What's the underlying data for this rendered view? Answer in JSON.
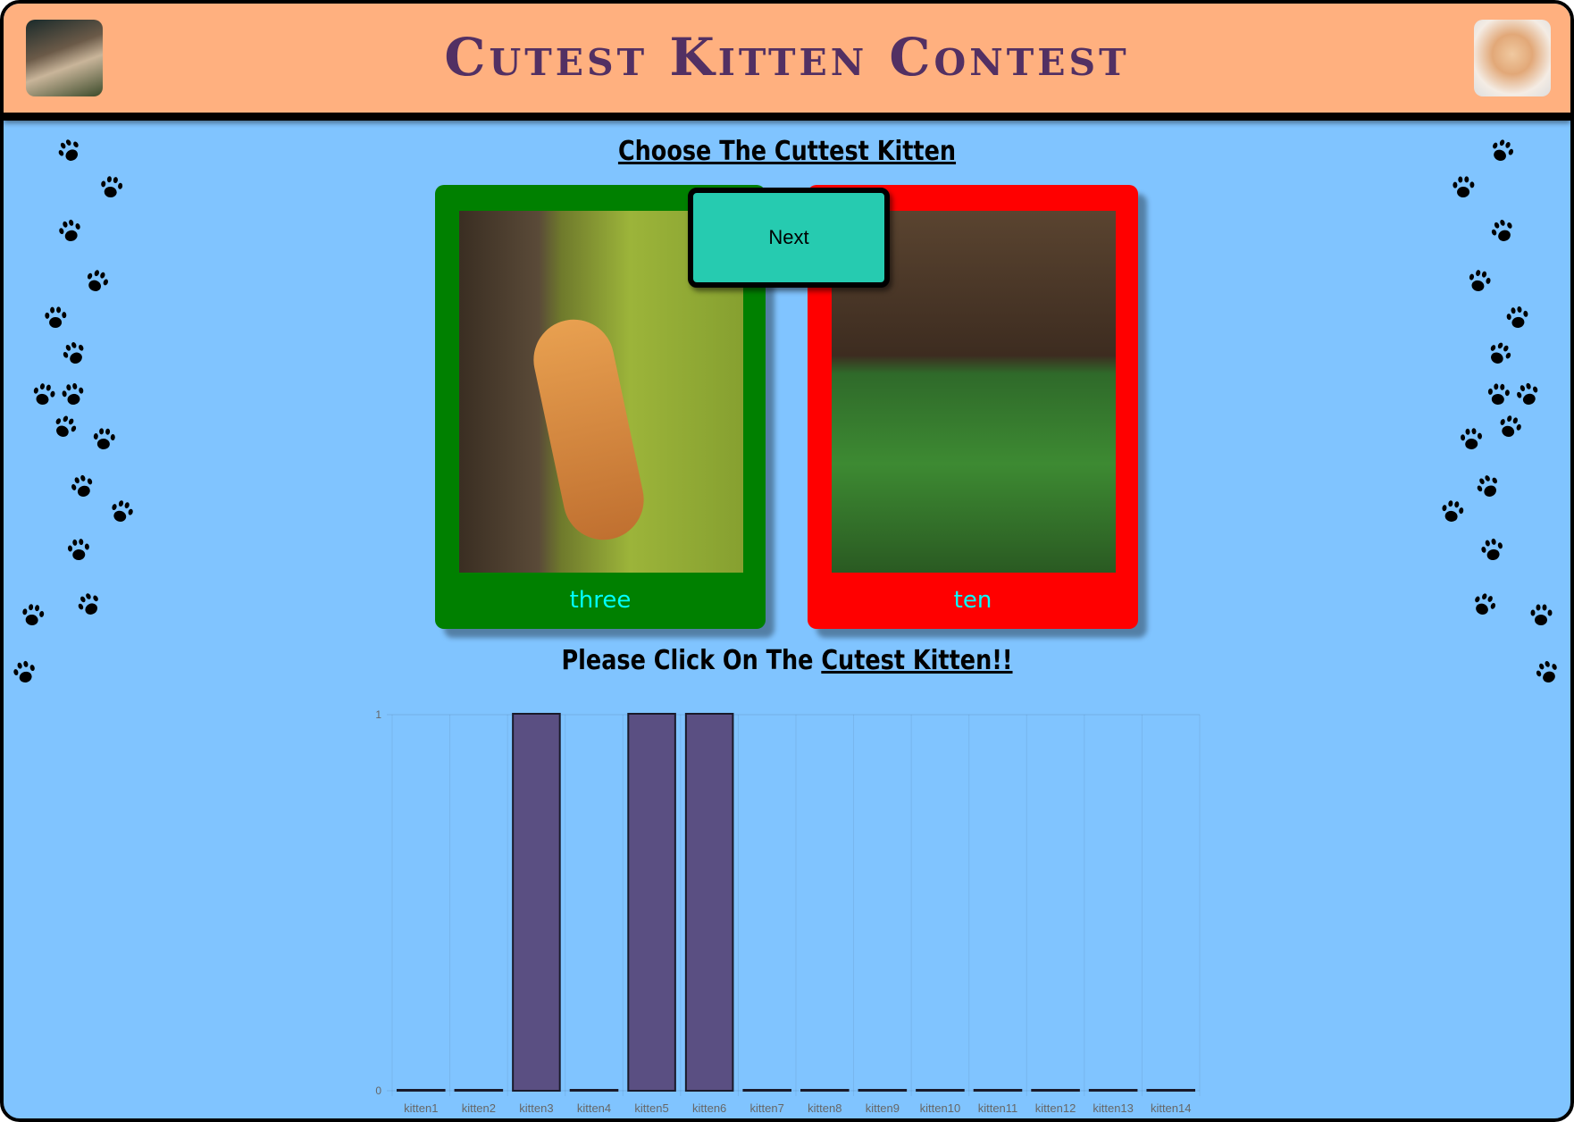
{
  "header": {
    "title": "Cutest Kitten Contest"
  },
  "main": {
    "heading": "Choose The Cuttest Kitten",
    "left_card": {
      "label": "three",
      "color": "#008000"
    },
    "right_card": {
      "label": "ten",
      "color": "#FF0000"
    },
    "next_label": "Next",
    "prompt_prefix": "Please Click On The ",
    "prompt_emphasis": "Cutest Kitten!!"
  },
  "chart_data": {
    "type": "bar",
    "categories": [
      "kitten1",
      "kitten2",
      "kitten3",
      "kitten4",
      "kitten5",
      "kitten6",
      "kitten7",
      "kitten8",
      "kitten9",
      "kitten10",
      "kitten11",
      "kitten12",
      "kitten13",
      "kitten14"
    ],
    "values": [
      0,
      0,
      1,
      0,
      1,
      1,
      0,
      0,
      0,
      0,
      0,
      0,
      0,
      0
    ],
    "ylim": [
      0,
      1
    ],
    "yticks": [
      "0",
      "1"
    ],
    "bar_color": "#5A4F82",
    "grid": true,
    "title": "",
    "xlabel": "",
    "ylabel": ""
  }
}
